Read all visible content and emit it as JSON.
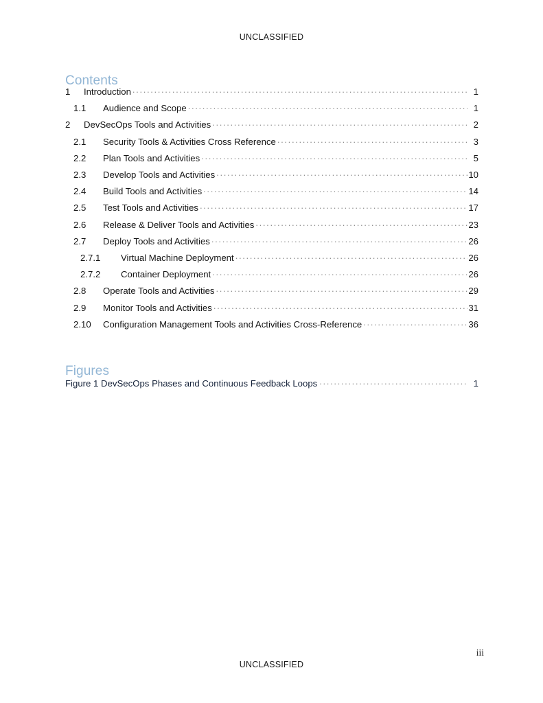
{
  "document": {
    "classification_header": "UNCLASSIFIED",
    "classification_footer": "UNCLASSIFIED",
    "page_number": "iii"
  },
  "contents": {
    "heading": "Contents",
    "entries": [
      {
        "level": 1,
        "number": "1",
        "title": "Introduction",
        "page": "1"
      },
      {
        "level": 2,
        "number": "1.1",
        "title": "Audience and Scope",
        "page": "1"
      },
      {
        "level": 1,
        "number": "2",
        "title": "DevSecOps Tools and Activities",
        "page": "2"
      },
      {
        "level": 2,
        "number": "2.1",
        "title": "Security Tools & Activities Cross Reference",
        "page": "3"
      },
      {
        "level": 2,
        "number": "2.2",
        "title": "Plan Tools and Activities",
        "page": "5"
      },
      {
        "level": 2,
        "number": "2.3",
        "title": "Develop Tools and Activities",
        "page": "10"
      },
      {
        "level": 2,
        "number": "2.4",
        "title": "Build Tools and Activities",
        "page": "14"
      },
      {
        "level": 2,
        "number": "2.5",
        "title": "Test Tools and Activities",
        "page": "17"
      },
      {
        "level": 2,
        "number": "2.6",
        "title": "Release & Deliver Tools and Activities",
        "page": "23"
      },
      {
        "level": 2,
        "number": "2.7",
        "title": "Deploy Tools and Activities",
        "page": "26"
      },
      {
        "level": 3,
        "number": "2.7.1",
        "title": "Virtual Machine Deployment",
        "page": "26"
      },
      {
        "level": 3,
        "number": "2.7.2",
        "title": "Container Deployment",
        "page": "26"
      },
      {
        "level": 2,
        "number": "2.8",
        "title": "Operate Tools and Activities",
        "page": "29"
      },
      {
        "level": 2,
        "number": "2.9",
        "title": "Monitor Tools and Activities",
        "page": "31"
      },
      {
        "level": 2,
        "number": "2.10",
        "title": "Configuration Management Tools and Activities Cross-Reference",
        "page": "36"
      }
    ]
  },
  "figures": {
    "heading": "Figures",
    "entries": [
      {
        "title": "Figure 1 DevSecOps Phases and Continuous Feedback Loops",
        "page": "1"
      }
    ]
  },
  "colors": {
    "heading_blue": "#92b6d5",
    "body_text": "#141414",
    "leader_dots": "#8d8d8d",
    "figure_entry_text": "#16233a",
    "page_background": "#ffffff"
  }
}
